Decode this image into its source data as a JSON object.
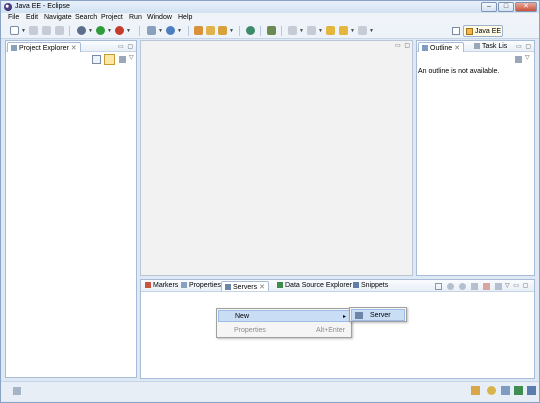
{
  "window": {
    "title": "Java EE - Eclipse",
    "minimize": "–",
    "maximize": "□",
    "close": "✕"
  },
  "menubar": [
    {
      "label": "File"
    },
    {
      "label": "Edit"
    },
    {
      "label": "Navigate"
    },
    {
      "label": "Search"
    },
    {
      "label": "Project"
    },
    {
      "label": "Run"
    },
    {
      "label": "Window"
    },
    {
      "label": "Help"
    }
  ],
  "perspective": {
    "label": "Java EE"
  },
  "project_explorer": {
    "tab_label": "Project Explorer",
    "close": "✕"
  },
  "outline": {
    "tab_label": "Outline",
    "close": "✕",
    "tab2_label": "Task Lis",
    "message": "An outline is not available."
  },
  "bottom": {
    "tabs": [
      {
        "label": "Markers"
      },
      {
        "label": "Properties"
      },
      {
        "label": "Servers"
      },
      {
        "label": "Data Source Explorer"
      },
      {
        "label": "Snippets"
      }
    ],
    "close": "✕"
  },
  "context_menu": {
    "new_label": "New",
    "new_arrow": "▸",
    "properties_label": "Properties",
    "properties_shortcut": "Alt+Enter"
  },
  "submenu": {
    "server_label": "Server"
  },
  "colors": {
    "accent": "#c9ddf5",
    "frame": "#dfe9f5"
  }
}
